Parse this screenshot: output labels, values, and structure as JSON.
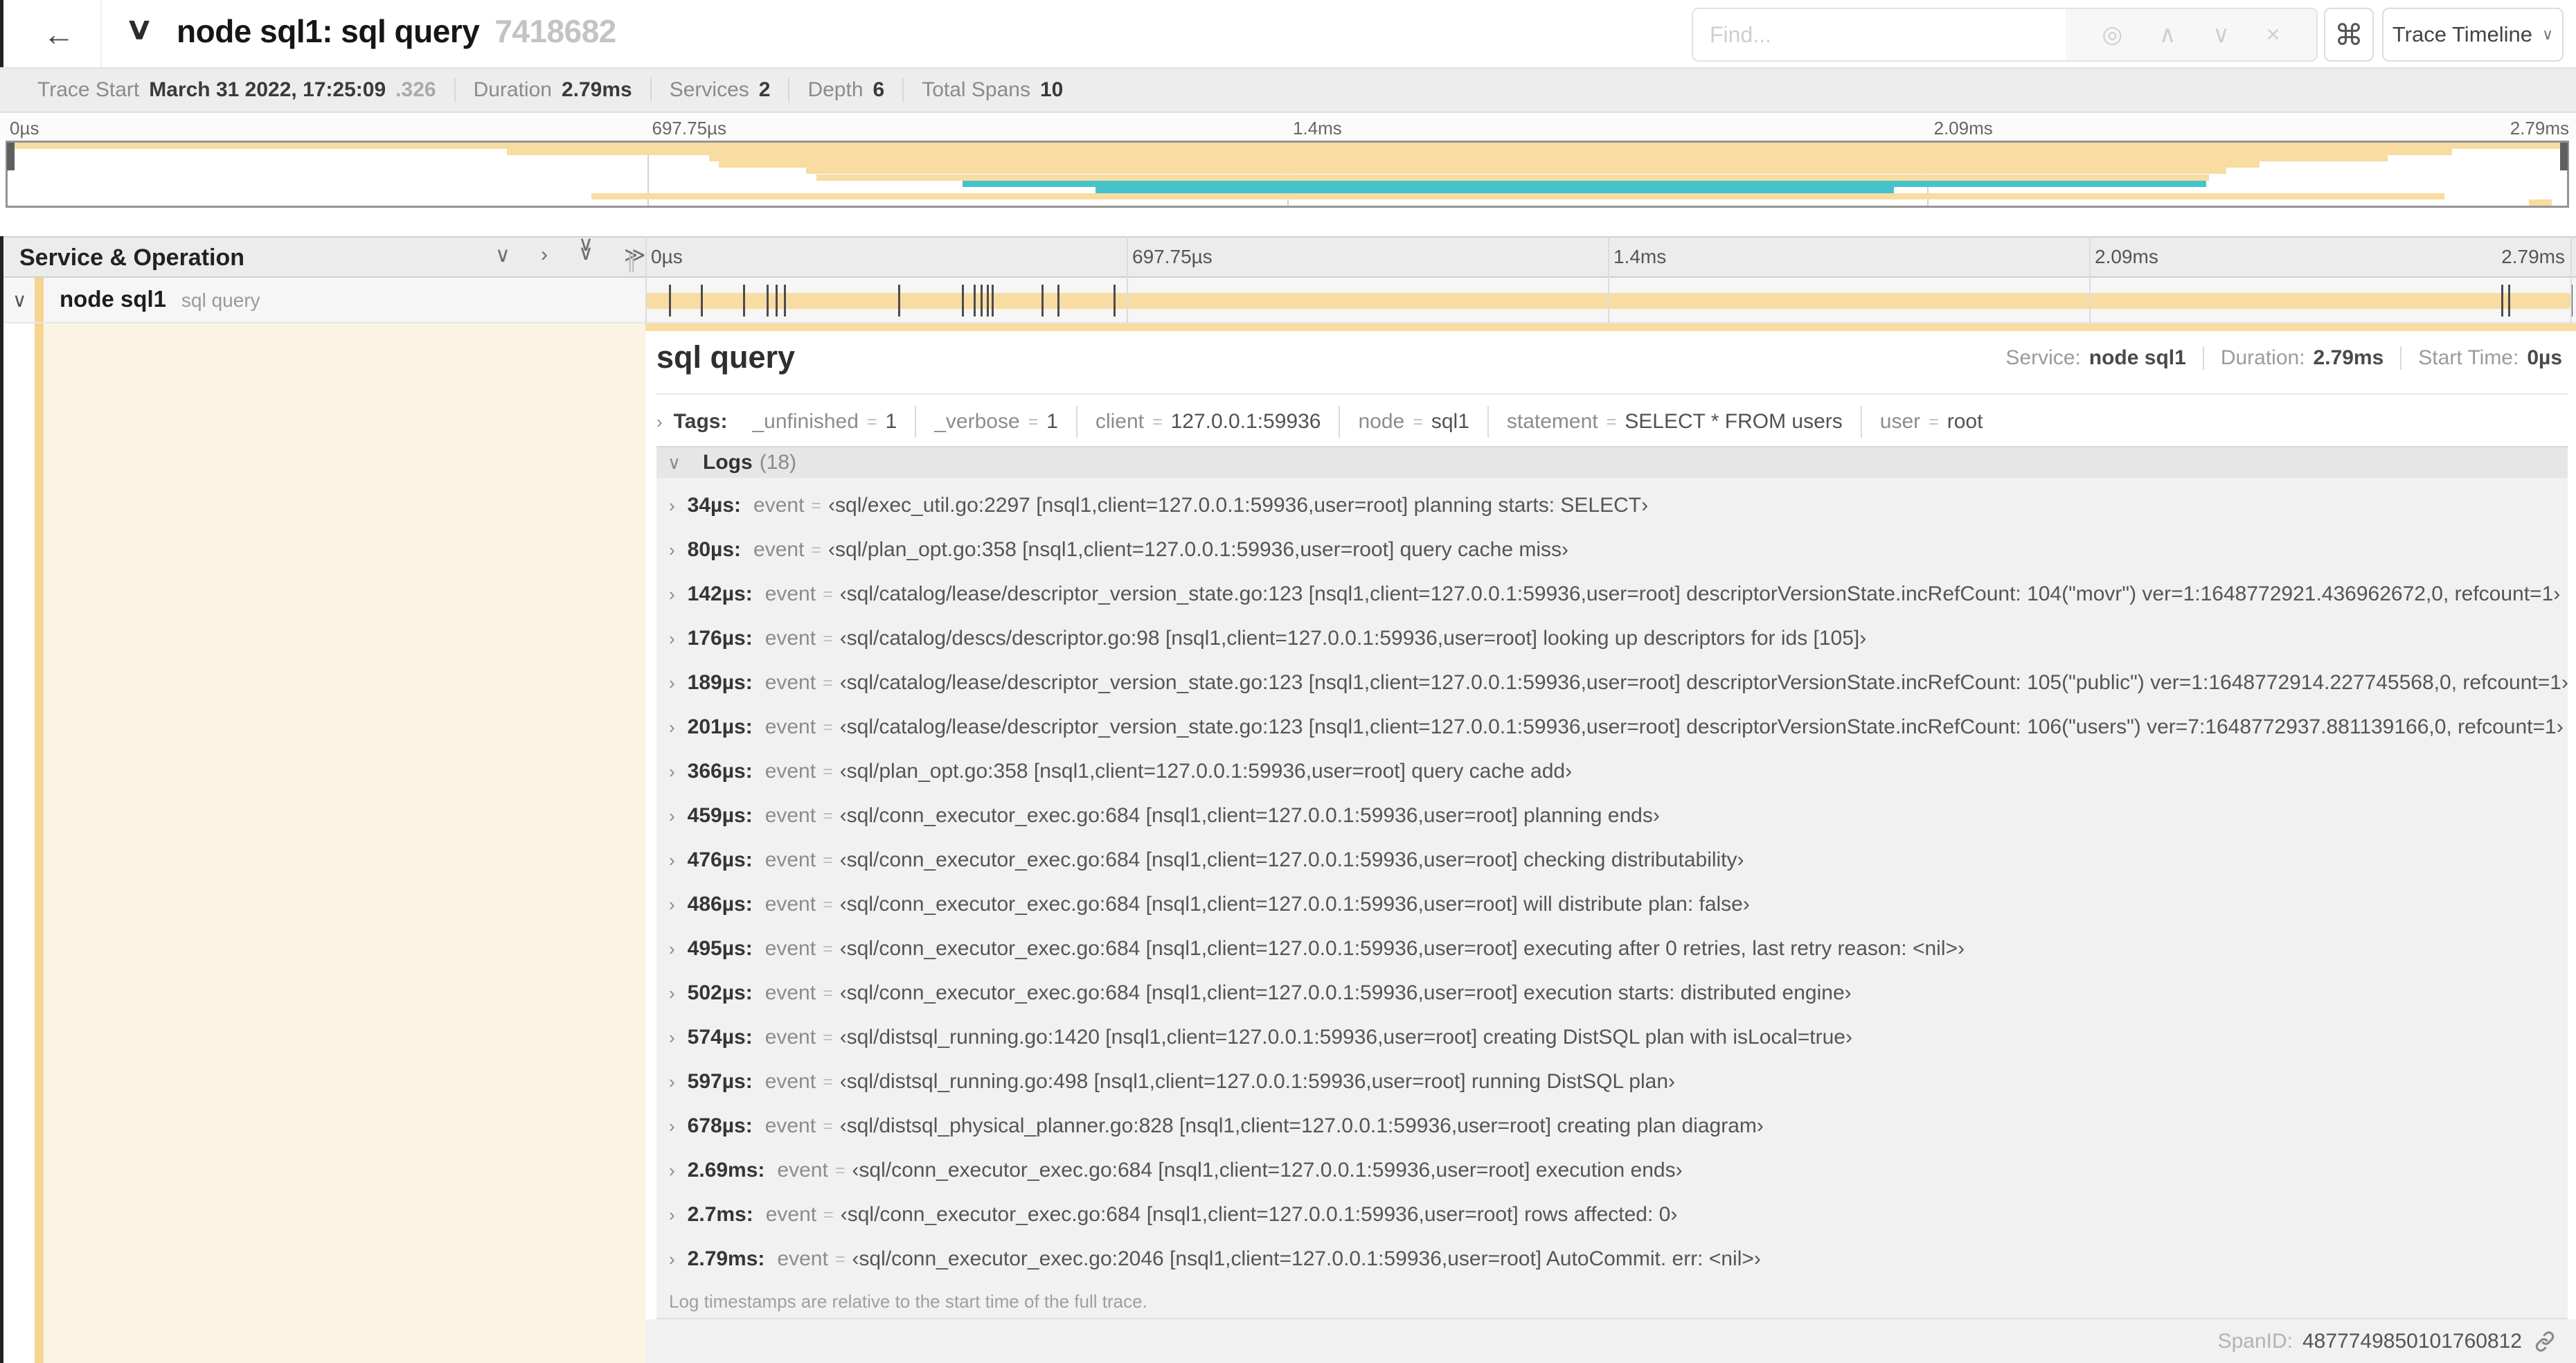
{
  "colors": {
    "tan": "#f8dca2",
    "tan_strip": "#f6d491",
    "teal": "#46c2ca",
    "cream": "#fcf4e3",
    "tick": "#4c4c4c"
  },
  "header": {
    "back_icon": "←",
    "collapse_icon": "∨",
    "title": "node sql1: sql query",
    "trace_id": "7418682",
    "find_placeholder": "Find...",
    "locate_icon": "◎",
    "prev_icon": "∧",
    "next_icon": "∨",
    "clear_icon": "×",
    "shortcut_icon": "⌘",
    "view_select_label": "Trace Timeline",
    "view_select_caret": "∨"
  },
  "summary": {
    "items": [
      {
        "label": "Trace Start",
        "value": "March 31 2022, 17:25:09",
        "suffix": ".326"
      },
      {
        "label": "Duration",
        "value": "2.79ms",
        "suffix": ""
      },
      {
        "label": "Services",
        "value": "2",
        "suffix": ""
      },
      {
        "label": "Depth",
        "value": "6",
        "suffix": ""
      },
      {
        "label": "Total Spans",
        "value": "10",
        "suffix": ""
      }
    ]
  },
  "ruler": {
    "labels": [
      {
        "f": 0,
        "label": "0µs",
        "align": "left"
      },
      {
        "f": 0.25,
        "label": "697.75µs",
        "align": "left"
      },
      {
        "f": 0.5,
        "label": "1.4ms",
        "align": "left"
      },
      {
        "f": 0.75,
        "label": "2.09ms",
        "align": "left"
      },
      {
        "f": 1,
        "label": "2.79ms",
        "align": "right"
      }
    ]
  },
  "minimap": {
    "spans": [
      {
        "row": 0,
        "start": 0.0,
        "end": 1.0,
        "color": "tan"
      },
      {
        "row": 1,
        "start": 0.195,
        "end": 0.955,
        "color": "tan"
      },
      {
        "row": 2,
        "start": 0.274,
        "end": 0.93,
        "color": "tan"
      },
      {
        "row": 3,
        "start": 0.278,
        "end": 0.88,
        "color": "tan"
      },
      {
        "row": 4,
        "start": 0.312,
        "end": 0.867,
        "color": "tan"
      },
      {
        "row": 5,
        "start": 0.316,
        "end": 0.86,
        "color": "tan"
      },
      {
        "row": 6,
        "start": 0.373,
        "end": 0.859,
        "color": "teal"
      },
      {
        "row": 7,
        "start": 0.425,
        "end": 0.737,
        "color": "teal"
      },
      {
        "row": 8,
        "start": 0.228,
        "end": 0.952,
        "color": "tan"
      },
      {
        "row": 9,
        "start": 0.985,
        "end": 0.994,
        "color": "tan"
      }
    ]
  },
  "timeline_header": {
    "column_title": "Service & Operation",
    "collapse_one_icon": "∨",
    "expand_one_icon": "›",
    "collapse_all_icon": "∨∨",
    "expand_all_icon": "≫",
    "drag_handle_icon": "∥"
  },
  "span_row": {
    "caret": "∨",
    "service": "node sql1",
    "operation": "sql query",
    "duration_total_us": 2790,
    "tick_times_us": [
      34,
      80,
      142,
      176,
      189,
      201,
      366,
      459,
      476,
      486,
      495,
      502,
      574,
      597,
      678,
      2690,
      2700,
      2790
    ]
  },
  "span_detail": {
    "title": "sql query",
    "meta": [
      {
        "label": "Service:",
        "value": "node sql1"
      },
      {
        "label": "Duration:",
        "value": "2.79ms"
      },
      {
        "label": "Start Time:",
        "value": "0µs"
      }
    ],
    "tags_caret": "›",
    "tags_label": "Tags:",
    "tags": [
      {
        "key": "_unfinished",
        "value": "1"
      },
      {
        "key": "_verbose",
        "value": "1"
      },
      {
        "key": "client",
        "value": "127.0.0.1:59936"
      },
      {
        "key": "node",
        "value": "sql1"
      },
      {
        "key": "statement",
        "value": "SELECT * FROM users"
      },
      {
        "key": "user",
        "value": "root"
      }
    ],
    "logs_caret": "∨",
    "logs_label": "Logs",
    "logs_count": "(18)",
    "log_field_key": "event",
    "log_eq": "=",
    "logs": [
      {
        "time": "34µs:",
        "value": "‹sql/exec_util.go:2297 [nsql1,client=127.0.0.1:59936,user=root] planning starts: SELECT›"
      },
      {
        "time": "80µs:",
        "value": "‹sql/plan_opt.go:358 [nsql1,client=127.0.0.1:59936,user=root] query cache miss›"
      },
      {
        "time": "142µs:",
        "value": "‹sql/catalog/lease/descriptor_version_state.go:123 [nsql1,client=127.0.0.1:59936,user=root] descriptorVersionState.incRefCount: 104(\"movr\") ver=1:1648772921.436962672,0, refcount=1›"
      },
      {
        "time": "176µs:",
        "value": "‹sql/catalog/descs/descriptor.go:98 [nsql1,client=127.0.0.1:59936,user=root] looking up descriptors for ids [105]›"
      },
      {
        "time": "189µs:",
        "value": "‹sql/catalog/lease/descriptor_version_state.go:123 [nsql1,client=127.0.0.1:59936,user=root] descriptorVersionState.incRefCount: 105(\"public\") ver=1:1648772914.227745568,0, refcount=1›"
      },
      {
        "time": "201µs:",
        "value": "‹sql/catalog/lease/descriptor_version_state.go:123 [nsql1,client=127.0.0.1:59936,user=root] descriptorVersionState.incRefCount: 106(\"users\") ver=7:1648772937.881139166,0, refcount=1›"
      },
      {
        "time": "366µs:",
        "value": "‹sql/plan_opt.go:358 [nsql1,client=127.0.0.1:59936,user=root] query cache add›"
      },
      {
        "time": "459µs:",
        "value": "‹sql/conn_executor_exec.go:684 [nsql1,client=127.0.0.1:59936,user=root] planning ends›"
      },
      {
        "time": "476µs:",
        "value": "‹sql/conn_executor_exec.go:684 [nsql1,client=127.0.0.1:59936,user=root] checking distributability›"
      },
      {
        "time": "486µs:",
        "value": "‹sql/conn_executor_exec.go:684 [nsql1,client=127.0.0.1:59936,user=root] will distribute plan: false›"
      },
      {
        "time": "495µs:",
        "value": "‹sql/conn_executor_exec.go:684 [nsql1,client=127.0.0.1:59936,user=root] executing after 0 retries, last retry reason: <nil>›"
      },
      {
        "time": "502µs:",
        "value": "‹sql/conn_executor_exec.go:684 [nsql1,client=127.0.0.1:59936,user=root] execution starts: distributed engine›"
      },
      {
        "time": "574µs:",
        "value": "‹sql/distsql_running.go:1420 [nsql1,client=127.0.0.1:59936,user=root] creating DistSQL plan with isLocal=true›"
      },
      {
        "time": "597µs:",
        "value": "‹sql/distsql_running.go:498 [nsql1,client=127.0.0.1:59936,user=root] running DistSQL plan›"
      },
      {
        "time": "678µs:",
        "value": "‹sql/distsql_physical_planner.go:828 [nsql1,client=127.0.0.1:59936,user=root] creating plan diagram›"
      },
      {
        "time": "2.69ms:",
        "value": "‹sql/conn_executor_exec.go:684 [nsql1,client=127.0.0.1:59936,user=root] execution ends›"
      },
      {
        "time": "2.7ms:",
        "value": "‹sql/conn_executor_exec.go:684 [nsql1,client=127.0.0.1:59936,user=root] rows affected: 0›"
      },
      {
        "time": "2.79ms:",
        "value": "‹sql/conn_executor_exec.go:2046 [nsql1,client=127.0.0.1:59936,user=root] AutoCommit. err: <nil>›"
      }
    ],
    "logs_note": "Log timestamps are relative to the start time of the full trace.",
    "span_id_label": "SpanID:",
    "span_id": "4877749850101760812"
  }
}
